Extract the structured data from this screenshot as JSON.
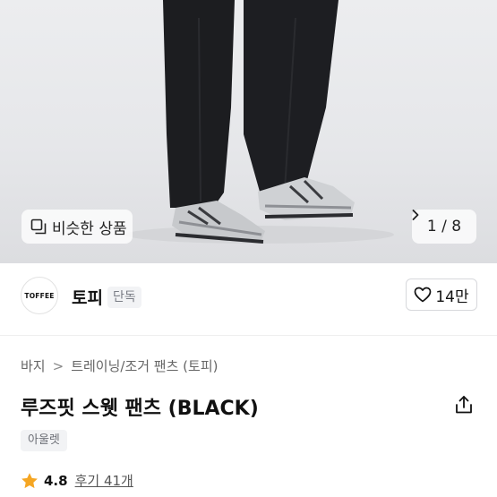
{
  "gallery": {
    "similar_label": "비슷한 상품",
    "current_page": "1",
    "page_separator": "/",
    "total_pages": "8"
  },
  "brand": {
    "logo_text": "TOFFEE",
    "name": "토피",
    "badge": "단독",
    "like_count": "14만"
  },
  "product": {
    "breadcrumb": [
      "바지",
      "트레이닝/조거 팬츠 (토피)"
    ],
    "breadcrumb_separator": ">",
    "title": "루즈핏 스웻 팬츠 (BLACK)",
    "tag": "아울렛",
    "rating": "4.8",
    "reviews_label": "후기 41개"
  },
  "colors": {
    "star": "#f5a623",
    "pants": "#1c1d20",
    "background": "#e8e9ec"
  }
}
